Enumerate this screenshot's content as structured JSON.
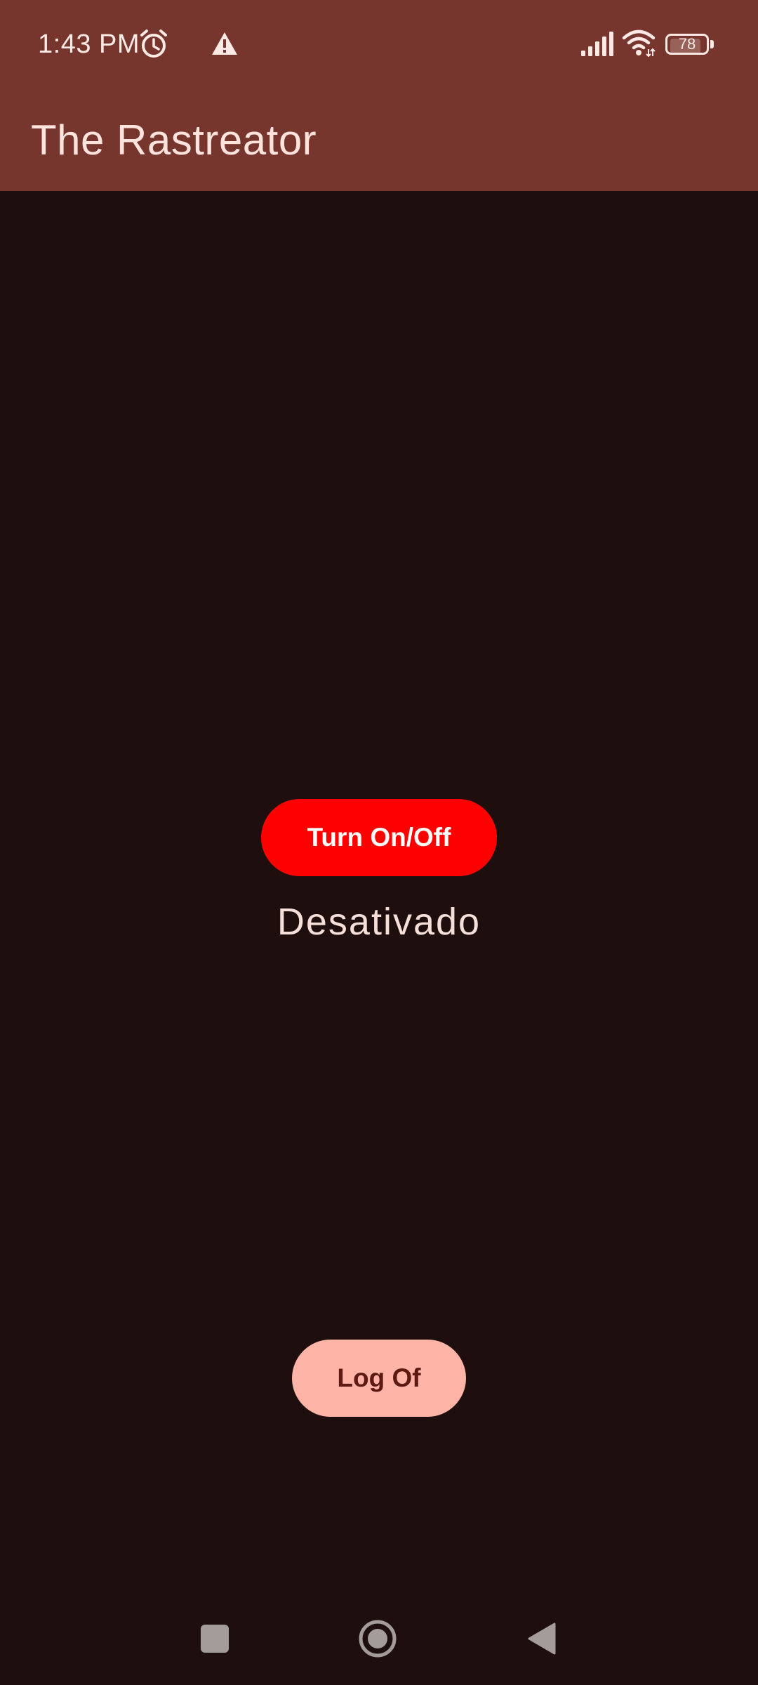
{
  "status_bar": {
    "time": "1:43 PM",
    "battery_level": "78",
    "icons": [
      "alarm-icon",
      "warning-icon",
      "signal-icon",
      "wifi-icon",
      "battery-icon"
    ]
  },
  "app_bar": {
    "title": "The Rastreator"
  },
  "main": {
    "toggle_button_label": "Turn On/Off",
    "state_text": "Desativado",
    "logoff_button_label": "Log Of"
  },
  "colors": {
    "app_bar": "#76352d",
    "background": "#1e0f0e",
    "toggle_button": "#ff0000",
    "logoff_button": "#ffb4a8"
  },
  "nav_bar": {
    "icons": [
      "recents-icon",
      "home-icon",
      "back-icon"
    ]
  }
}
